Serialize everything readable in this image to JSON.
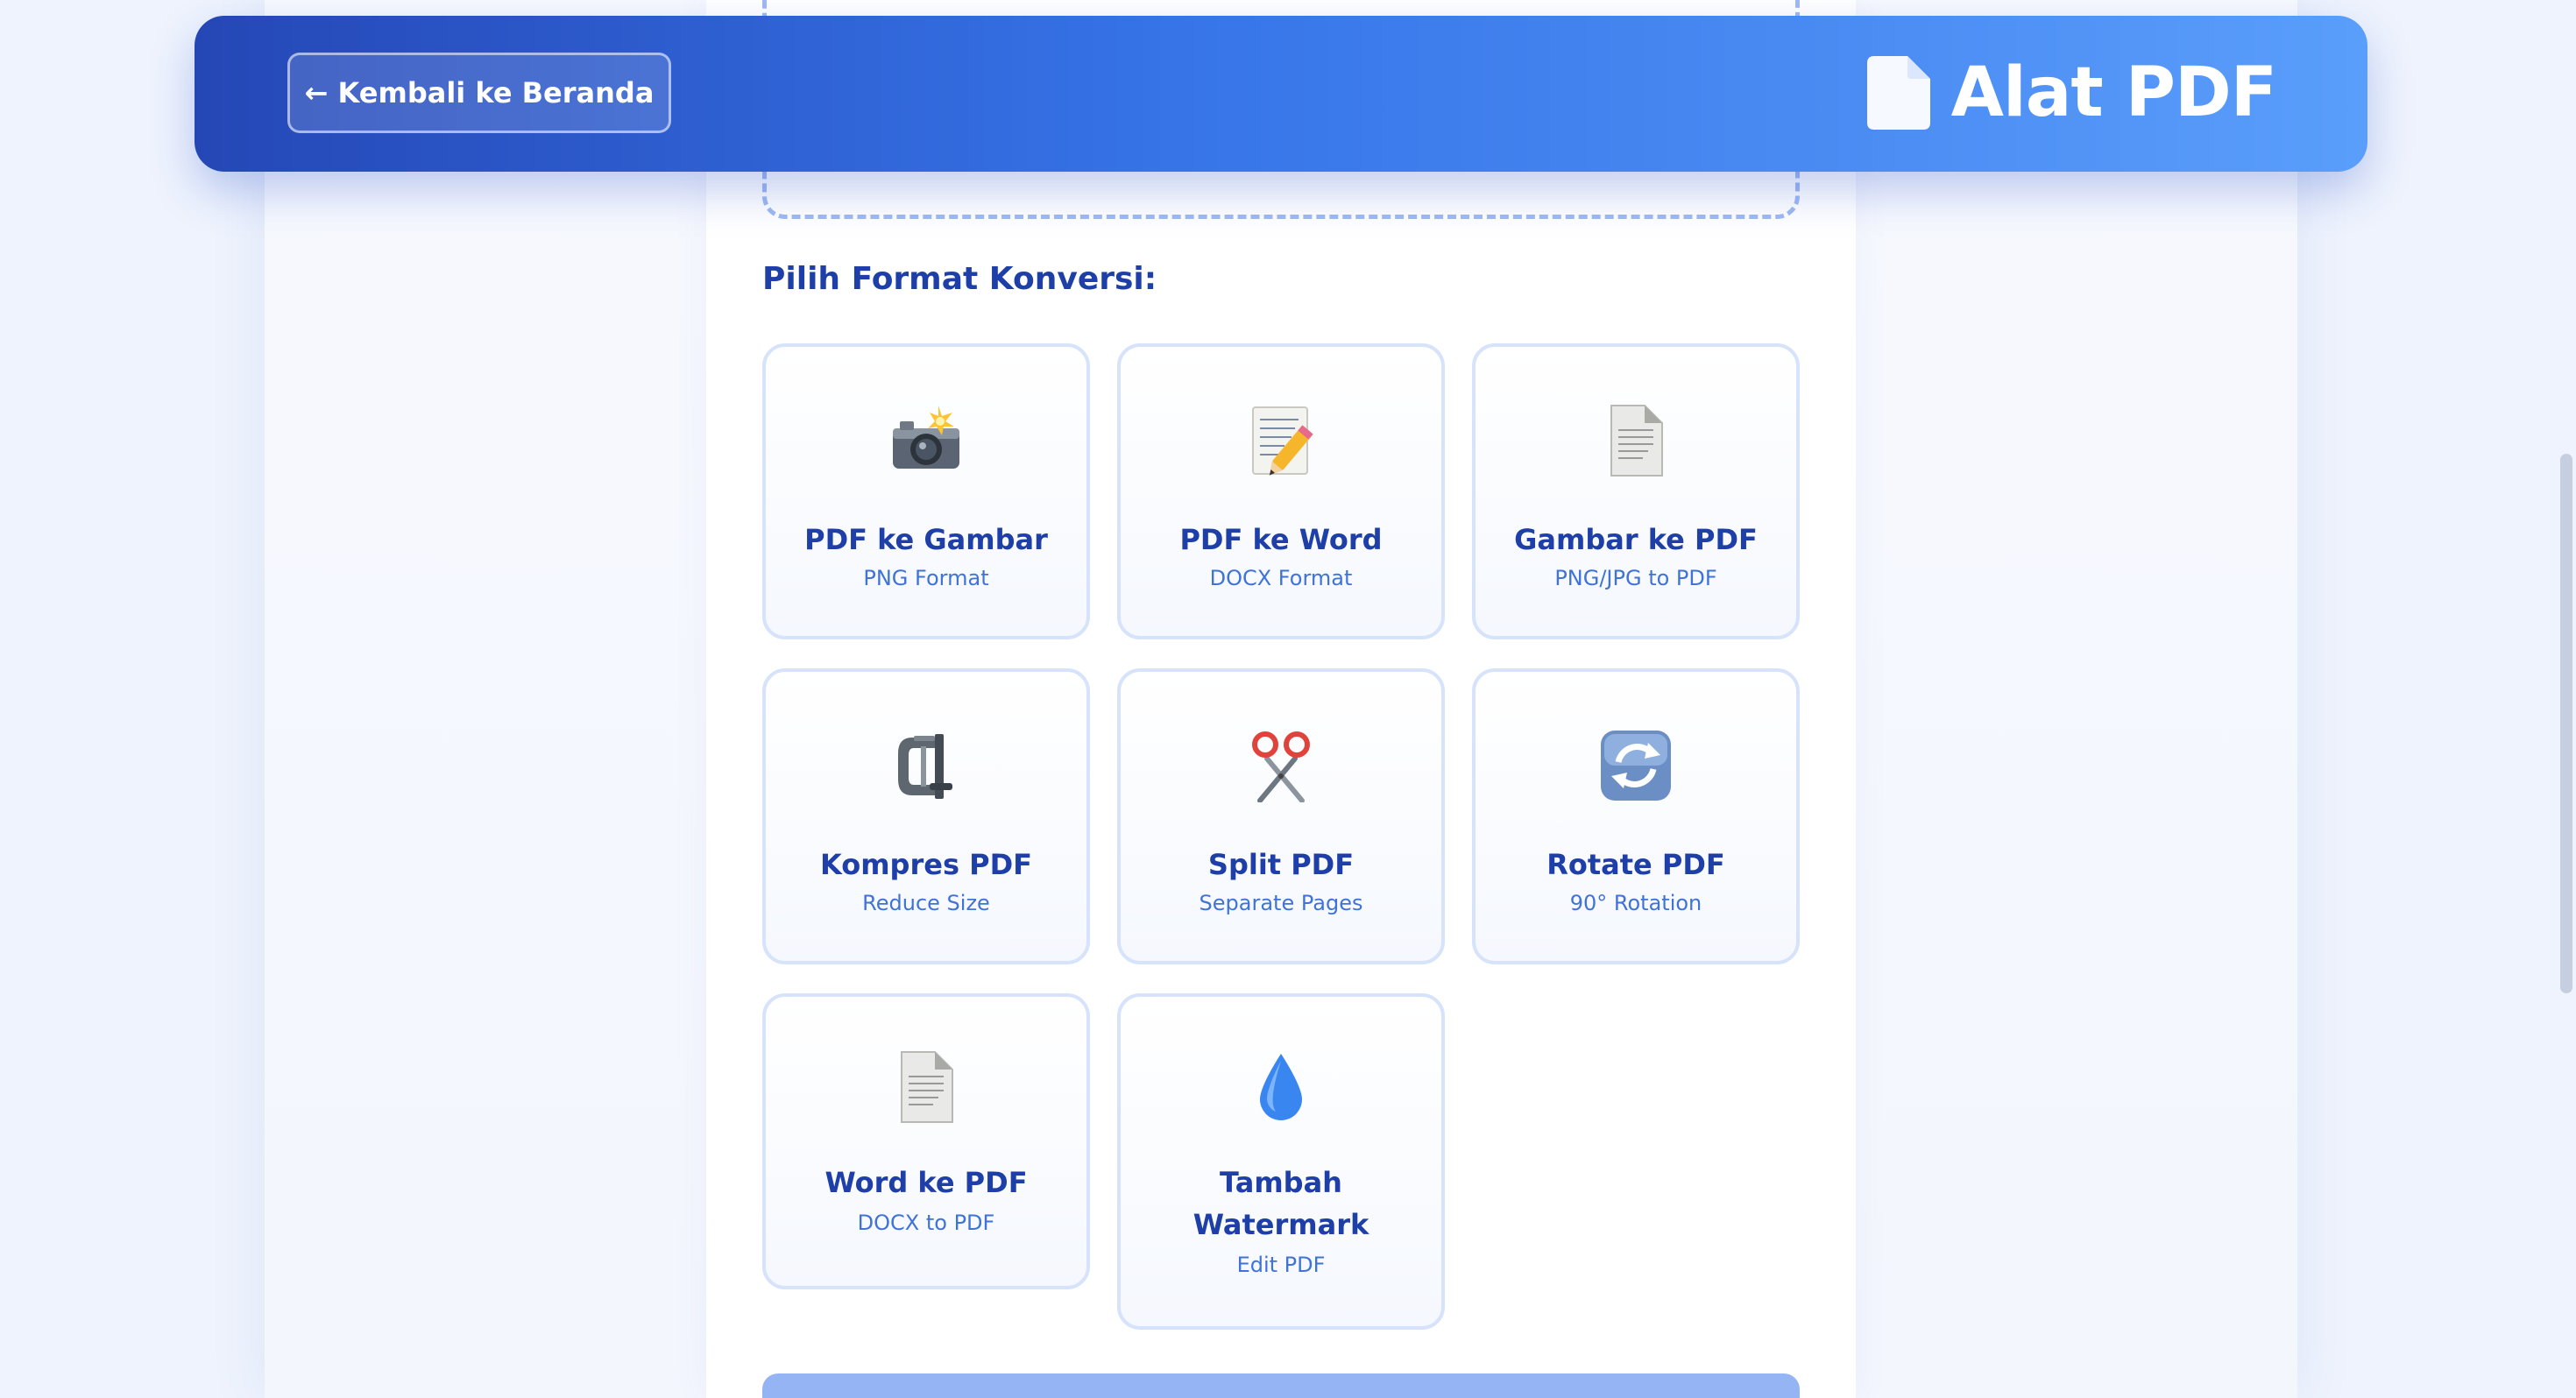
{
  "header": {
    "back_label": "← Kembali ke Beranda",
    "brand_title": "Alat PDF",
    "brand_icon": "document-icon",
    "gradient": [
      "#2547b6",
      "#3674e8",
      "#5a9efb"
    ]
  },
  "section_title": "Pilih Format Konversi:",
  "cards": [
    {
      "title": "PDF ke Gambar",
      "subtitle": "PNG Format",
      "icon": "camera-flash-icon"
    },
    {
      "title": "PDF ke Word",
      "subtitle": "DOCX Format",
      "icon": "memo-pencil-icon"
    },
    {
      "title": "Gambar ke PDF",
      "subtitle": "PNG/JPG to PDF",
      "icon": "page-icon"
    },
    {
      "title": "Kompres PDF",
      "subtitle": "Reduce Size",
      "icon": "clamp-icon"
    },
    {
      "title": "Split PDF",
      "subtitle": "Separate Pages",
      "icon": "scissors-icon"
    },
    {
      "title": "Rotate PDF",
      "subtitle": "90° Rotation",
      "icon": "rotate-arrows-icon"
    },
    {
      "title": "Word ke PDF",
      "subtitle": "DOCX to PDF",
      "icon": "page-icon"
    },
    {
      "title": "Tambah Watermark",
      "subtitle": "Edit PDF",
      "icon": "droplet-icon"
    }
  ],
  "colors": {
    "accent": "#1e3ea8",
    "subtitle": "#3f73d8",
    "card_border": "#d6e3fb"
  }
}
